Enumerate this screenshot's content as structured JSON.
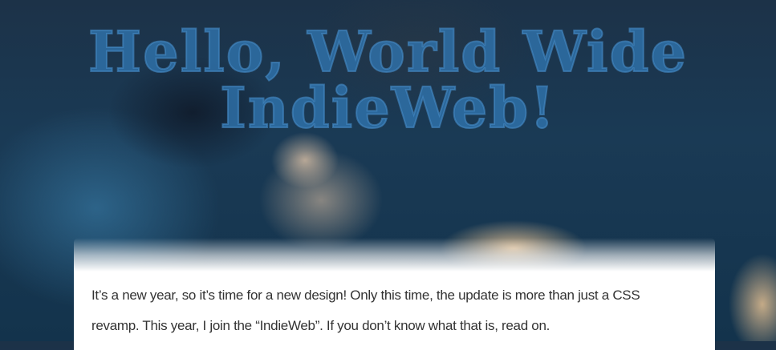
{
  "header": {
    "title": "Hello, World Wide IndieWeb!"
  },
  "article": {
    "intro": "It’s a new year, so it’s time for a new design! Only this time, the update is more than just a CSS revamp. This year, I join the “IndieWeb”. If you don’t know what that is, read on."
  }
}
